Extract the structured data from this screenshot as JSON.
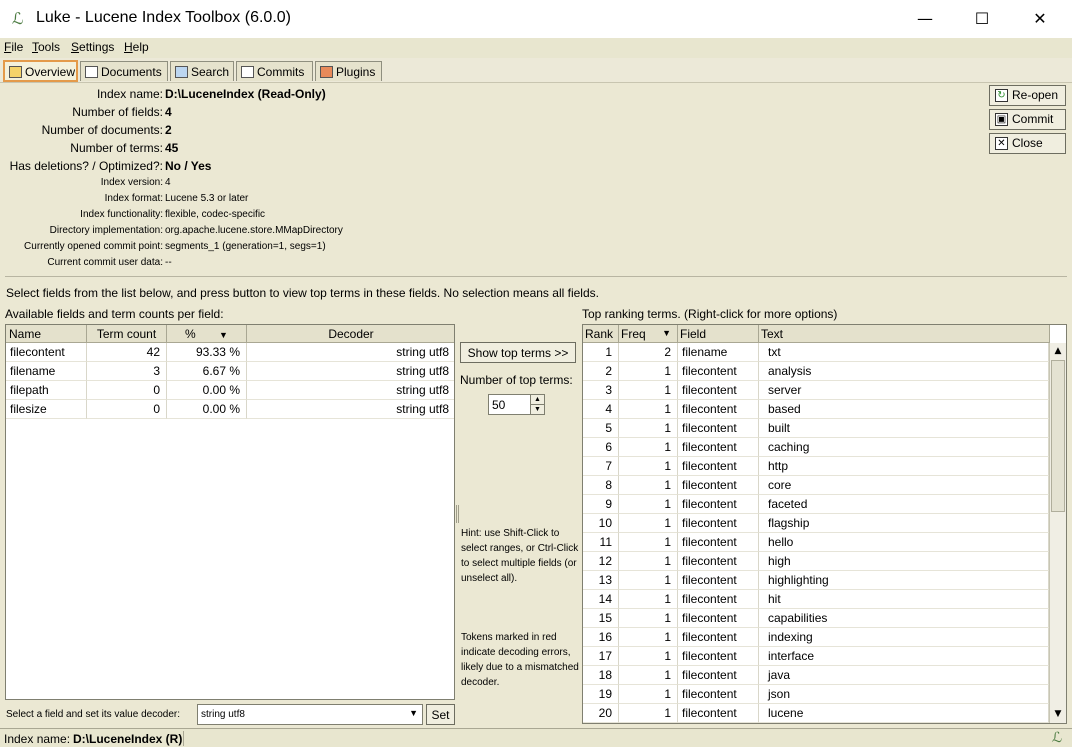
{
  "window": {
    "title": "Luke - Lucene Index Toolbox (6.0.0)",
    "minimize": "—",
    "maximize": "☐",
    "close": "✕"
  },
  "menu": [
    {
      "accel": "F",
      "rest": "ile"
    },
    {
      "accel": "T",
      "rest": "ools"
    },
    {
      "accel": "S",
      "rest": "ettings"
    },
    {
      "accel": "H",
      "rest": "elp"
    }
  ],
  "tabs": [
    "Overview",
    "Documents",
    "Search",
    "Commits",
    "Plugins"
  ],
  "overview": {
    "index_name_label": "Index name:",
    "index_name": "D:\\LuceneIndex (Read-Only)",
    "num_fields_label": "Number of fields:",
    "num_fields": "4",
    "num_docs_label": "Number of documents:",
    "num_docs": "2",
    "num_terms_label": "Number of terms:",
    "num_terms": "45",
    "deletions_label": "Has deletions? / Optimized?:",
    "deletions": "No / Yes",
    "version_label": "Index version:",
    "version": "4",
    "format_label": "Index format:",
    "format": "Lucene 5.3 or later",
    "functionality_label": "Index functionality:",
    "functionality": "flexible, codec-specific",
    "directory_label": "Directory implementation:",
    "directory": "org.apache.lucene.store.MMapDirectory",
    "commit_point_label": "Currently opened commit point:",
    "commit_point": "segments_1 (generation=1, segs=1)",
    "commit_user_label": "Current commit user data:",
    "commit_user": "--"
  },
  "right_buttons": {
    "reopen": "Re-open",
    "commit": "Commit",
    "close": "Close"
  },
  "instructions": "Select fields from the list below, and press button to view top terms in these fields. No selection means all fields.",
  "fields_panel": {
    "title": "Available fields and term counts per field:",
    "headers": [
      "Name",
      "Term count",
      "%",
      "Decoder"
    ],
    "rows": [
      [
        "filecontent",
        "42",
        "93.33 %",
        "string utf8"
      ],
      [
        "filename",
        "3",
        "6.67 %",
        "string utf8"
      ],
      [
        "filepath",
        "0",
        "0.00 %",
        "string utf8"
      ],
      [
        "filesize",
        "0",
        "0.00 %",
        "string utf8"
      ]
    ],
    "decoder_label": "Select a field and set its value decoder:",
    "decoder_value": "string utf8",
    "set_button": "Set"
  },
  "middle": {
    "show_button": "Show top terms >>",
    "num_top_label": "Number of top terms:",
    "num_top_value": "50",
    "hint1": "Hint: use Shift-Click to select ranges, or Ctrl-Click to select multiple fields (or unselect all).",
    "hint2": "Tokens marked in red indicate decoding errors, likely due to a mismatched decoder."
  },
  "terms_panel": {
    "title": "Top ranking terms. (Right-click for more options)",
    "headers": [
      "Rank",
      "Freq",
      "Field",
      "Text"
    ],
    "rows": [
      [
        "1",
        "2",
        "filename",
        "txt"
      ],
      [
        "2",
        "1",
        "filecontent",
        "analysis"
      ],
      [
        "3",
        "1",
        "filecontent",
        "server"
      ],
      [
        "4",
        "1",
        "filecontent",
        "based"
      ],
      [
        "5",
        "1",
        "filecontent",
        "built"
      ],
      [
        "6",
        "1",
        "filecontent",
        "caching"
      ],
      [
        "7",
        "1",
        "filecontent",
        "http"
      ],
      [
        "8",
        "1",
        "filecontent",
        "core"
      ],
      [
        "9",
        "1",
        "filecontent",
        "faceted"
      ],
      [
        "10",
        "1",
        "filecontent",
        "flagship"
      ],
      [
        "11",
        "1",
        "filecontent",
        "hello"
      ],
      [
        "12",
        "1",
        "filecontent",
        "high"
      ],
      [
        "13",
        "1",
        "filecontent",
        "highlighting"
      ],
      [
        "14",
        "1",
        "filecontent",
        "hit"
      ],
      [
        "15",
        "1",
        "filecontent",
        "capabilities"
      ],
      [
        "16",
        "1",
        "filecontent",
        "indexing"
      ],
      [
        "17",
        "1",
        "filecontent",
        "interface"
      ],
      [
        "18",
        "1",
        "filecontent",
        "java"
      ],
      [
        "19",
        "1",
        "filecontent",
        "json"
      ],
      [
        "20",
        "1",
        "filecontent",
        "lucene"
      ]
    ]
  },
  "status": {
    "label": "Index name:",
    "value": "D:\\LuceneIndex (R)"
  }
}
